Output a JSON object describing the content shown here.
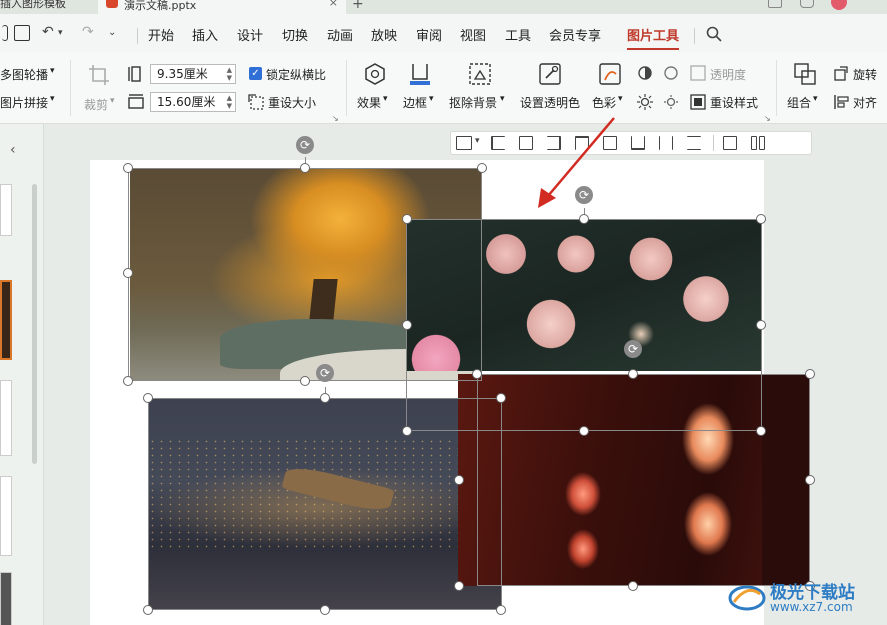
{
  "titlebar": {
    "prev_tab": "插入图形模板",
    "active_tab": "演示文稿.pptx",
    "close": "×",
    "new_tab": "+"
  },
  "menu": {
    "quick_undo": "↶",
    "quick_redo": "↷",
    "items": [
      "开始",
      "插入",
      "设计",
      "切换",
      "动画",
      "放映",
      "审阅",
      "视图",
      "工具",
      "会员专享",
      "图片工具"
    ],
    "active": "图片工具"
  },
  "ribbon": {
    "multi_outline": "多图轮播",
    "multi_splice": "图片拼接",
    "crop": "裁剪",
    "width_value": "9.35厘米",
    "height_value": "15.60厘米",
    "lock_ratio": "锁定纵横比",
    "reset_size": "重设大小",
    "effect": "效果",
    "border": "边框",
    "remove_bg": "抠除背景",
    "set_transparent": "设置透明色",
    "color": "色彩",
    "transparency": "透明度",
    "reset_style": "重设样式",
    "group": "组合",
    "rotate": "旋转",
    "align": "对齐"
  },
  "watermark": {
    "name": "极光下载站",
    "url": "www.xz7.com"
  }
}
